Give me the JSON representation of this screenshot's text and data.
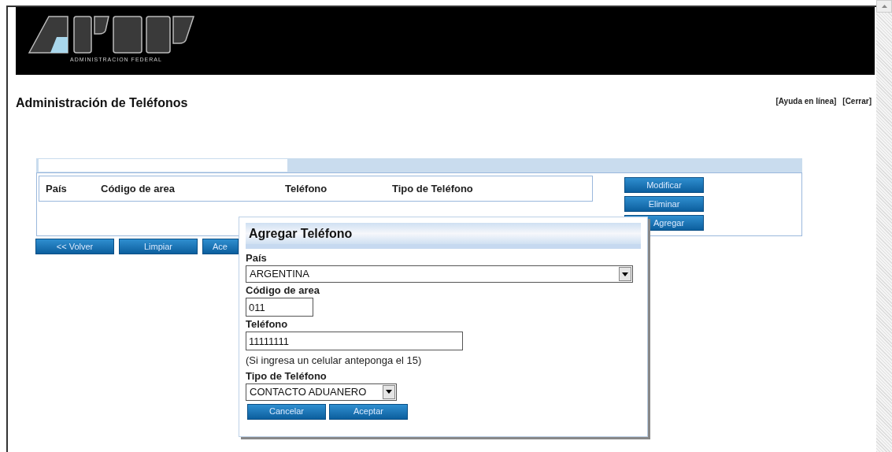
{
  "header": {
    "logo_caption": "ADMINISTRACION FEDERAL"
  },
  "page_title": "Administración de Teléfonos",
  "links": [
    "[Ayuda en línea]",
    "[Cerrar]"
  ],
  "table": {
    "columns": [
      "País",
      "Código de area",
      "Teléfono",
      "Tipo de Teléfono"
    ]
  },
  "side_buttons": [
    "Modificar",
    "Eliminar",
    "Agregar"
  ],
  "bottom_buttons": [
    "<< Volver",
    "Limpiar",
    "Ace"
  ],
  "dialog": {
    "title": "Agregar Teléfono",
    "fields": [
      {
        "kind": "select",
        "label": "País",
        "value": "ARGENTINA"
      },
      {
        "kind": "input",
        "label": "Código de area",
        "value": "011"
      },
      {
        "kind": "input",
        "label": "Teléfono",
        "value": "11111111",
        "hint": "(Si ingresa un celular anteponga el 15)"
      },
      {
        "kind": "select",
        "label": "Tipo de Teléfono",
        "value": "CONTACTO ADUANERO"
      }
    ],
    "buttons": [
      "Cancelar",
      "Aceptar"
    ]
  }
}
